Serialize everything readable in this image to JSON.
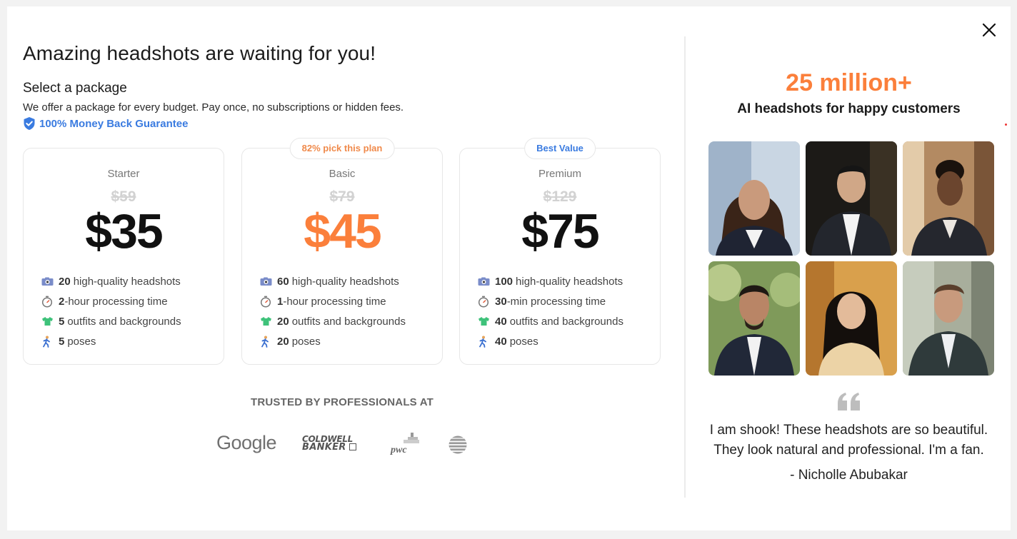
{
  "header": {
    "title": "Amazing headshots are waiting for you!",
    "select_heading": "Select a package",
    "description": "We offer a package for every budget. Pay once, no subscriptions or hidden fees.",
    "guarantee": "100% Money Back Guarantee"
  },
  "plans": [
    {
      "badge": "",
      "name": "Starter",
      "old_price": "$59",
      "price": "$35",
      "features": [
        {
          "icon": "photo-icon",
          "bold": "20",
          "text": "high-quality headshots"
        },
        {
          "icon": "timer-icon",
          "bold": "2",
          "text": "-hour processing time"
        },
        {
          "icon": "shirt-icon",
          "bold": "5",
          "text": "outfits and backgrounds"
        },
        {
          "icon": "pose-icon",
          "bold": "5",
          "text": "poses"
        }
      ]
    },
    {
      "badge": "82% pick this plan",
      "name": "Basic",
      "old_price": "$79",
      "price": "$45",
      "features": [
        {
          "icon": "photo-icon",
          "bold": "60",
          "text": "high-quality headshots"
        },
        {
          "icon": "timer-icon",
          "bold": "1",
          "text": "-hour processing time"
        },
        {
          "icon": "shirt-icon",
          "bold": "20",
          "text": "outfits and backgrounds"
        },
        {
          "icon": "pose-icon",
          "bold": "20",
          "text": "poses"
        }
      ]
    },
    {
      "badge": "Best Value",
      "name": "Premium",
      "old_price": "$129",
      "price": "$75",
      "features": [
        {
          "icon": "photo-icon",
          "bold": "100",
          "text": "high-quality headshots"
        },
        {
          "icon": "timer-icon",
          "bold": "30",
          "text": "-min processing time"
        },
        {
          "icon": "shirt-icon",
          "bold": "40",
          "text": "outfits and backgrounds"
        },
        {
          "icon": "pose-icon",
          "bold": "40",
          "text": "poses"
        }
      ]
    }
  ],
  "trusted": {
    "heading": "TRUSTED BY PROFESSIONALS AT",
    "logos": {
      "google": "Google",
      "coldwell_line1": "COLDWELL",
      "coldwell_line2": "BANKER",
      "pwc": "pwc"
    }
  },
  "testimonial": {
    "stat": "25 million+",
    "stat_sub": "AI headshots for happy customers",
    "quote_line1": "I am shook! These headshots are so beautiful.",
    "quote_line2": "They look natural and professional. I'm a fan.",
    "author": "- Nicholle Abubakar"
  },
  "colors": {
    "accent_orange": "#fb7f3b",
    "accent_blue": "#3a7be0",
    "badge_orange_text": "#f08a4b",
    "badge_blue_text": "#3a7be0"
  }
}
